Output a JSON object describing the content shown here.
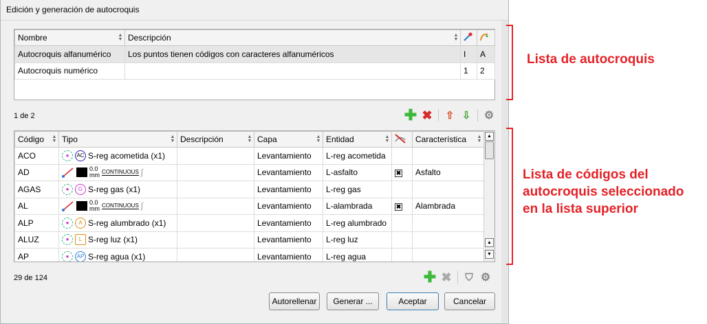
{
  "window": {
    "title": "Edición y generación de autocroquis"
  },
  "top_grid": {
    "columns": [
      "Nombre",
      "Descripción"
    ],
    "rows": [
      {
        "nombre": "Autocroquis alfanumérico",
        "descripcion": "Los puntos tienen códigos con caracteres alfanuméricos",
        "c1": "I",
        "c2": "A"
      },
      {
        "nombre": "Autocroquis numérico",
        "descripcion": "",
        "c1": "1",
        "c2": "2"
      }
    ],
    "status": "1 de 2"
  },
  "codes_grid": {
    "columns": [
      "Código",
      "Tipo",
      "Descripción",
      "Capa",
      "Entidad",
      "Característica"
    ],
    "rows": [
      {
        "codigo": "ACO",
        "glyph": "AC",
        "tipo": "S-reg acometida (x1)",
        "capa": "Levantamiento",
        "entidad": "L-reg acometida",
        "car": ""
      },
      {
        "codigo": "AD",
        "size": "0.0",
        "unit": "mm",
        "line": "CONTINUOUS",
        "capa": "Levantamiento",
        "entidad": "L-asfalto",
        "car": "Asfalto",
        "check": "✖"
      },
      {
        "codigo": "AGAS",
        "glyph": "G",
        "tipo": "S-reg gas (x1)",
        "capa": "Levantamiento",
        "entidad": "L-reg gas",
        "car": ""
      },
      {
        "codigo": "AL",
        "size": "0.0",
        "unit": "mm",
        "line": "CONTINUOUS",
        "capa": "Levantamiento",
        "entidad": "L-alambrada",
        "car": "Alambrada",
        "check": "✖"
      },
      {
        "codigo": "ALP",
        "glyph": "A",
        "tipo": "S-reg alumbrado (x1)",
        "capa": "Levantamiento",
        "entidad": "L-reg alumbrado",
        "car": ""
      },
      {
        "codigo": "ALUZ",
        "glyph": "L",
        "tipo": "S-reg luz (x1)",
        "capa": "Levantamiento",
        "entidad": "L-reg luz",
        "car": ""
      },
      {
        "codigo": "AP",
        "glyph": "AP",
        "tipo": "S-reg agua (x1)",
        "capa": "Levantamiento",
        "entidad": "L-reg agua",
        "car": ""
      }
    ],
    "status": "29 de 124"
  },
  "buttons": {
    "autofill": "Autorellenar",
    "generate": "Generar ...",
    "accept": "Aceptar",
    "cancel": "Cancelar"
  },
  "annotations": {
    "list": "Lista de autocroquis",
    "codes_l1": "Lista de códigos del",
    "codes_l2": "autocroquis seleccionado",
    "codes_l3": "en la lista superior"
  },
  "colors": {
    "annotation": "#e32227",
    "add": "#3db83a",
    "remove": "#d42a2a",
    "upload": "#d9542c",
    "download": "#4aa83c"
  }
}
